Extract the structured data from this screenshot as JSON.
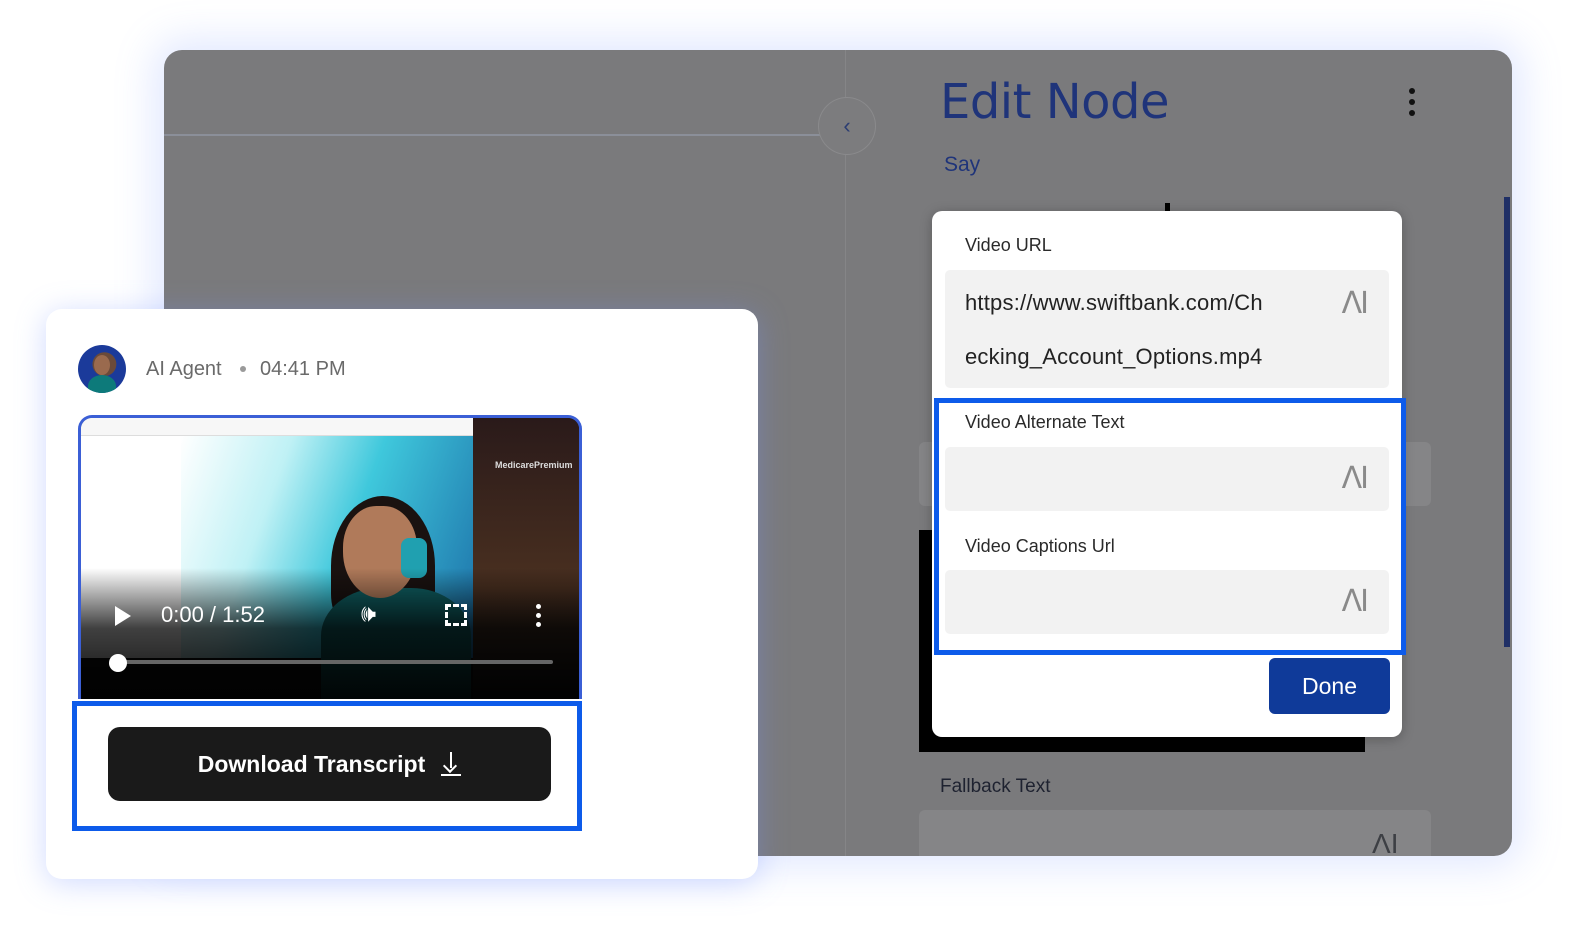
{
  "editor": {
    "title": "Edit Node",
    "say_label": "Say",
    "fallback_label": "Fallback Text",
    "ai_icon_text": "ΛI"
  },
  "video_dialog": {
    "url_label": "Video URL",
    "url_value_line1": "https://www.swiftbank.com/Ch",
    "url_value_line2": "ecking_Account_Options.mp4",
    "alt_text_label": "Video Alternate Text",
    "alt_text_value": "",
    "captions_label": "Video Captions Url",
    "captions_value": "",
    "ai_icon_text": "ΛI",
    "done_label": "Done"
  },
  "chat": {
    "agent_name": "AI Agent",
    "time": "04:41 PM",
    "video": {
      "time_display": "0:00 / 1:52",
      "progress": 0,
      "side_caption": "MedicarePremium"
    },
    "download_label": "Download Transcript"
  },
  "colors": {
    "accent_blue": "#0d5bea",
    "done_button": "#0f3a99",
    "title_blue": "#1f347a",
    "transcript_button": "#1a1a1a"
  }
}
